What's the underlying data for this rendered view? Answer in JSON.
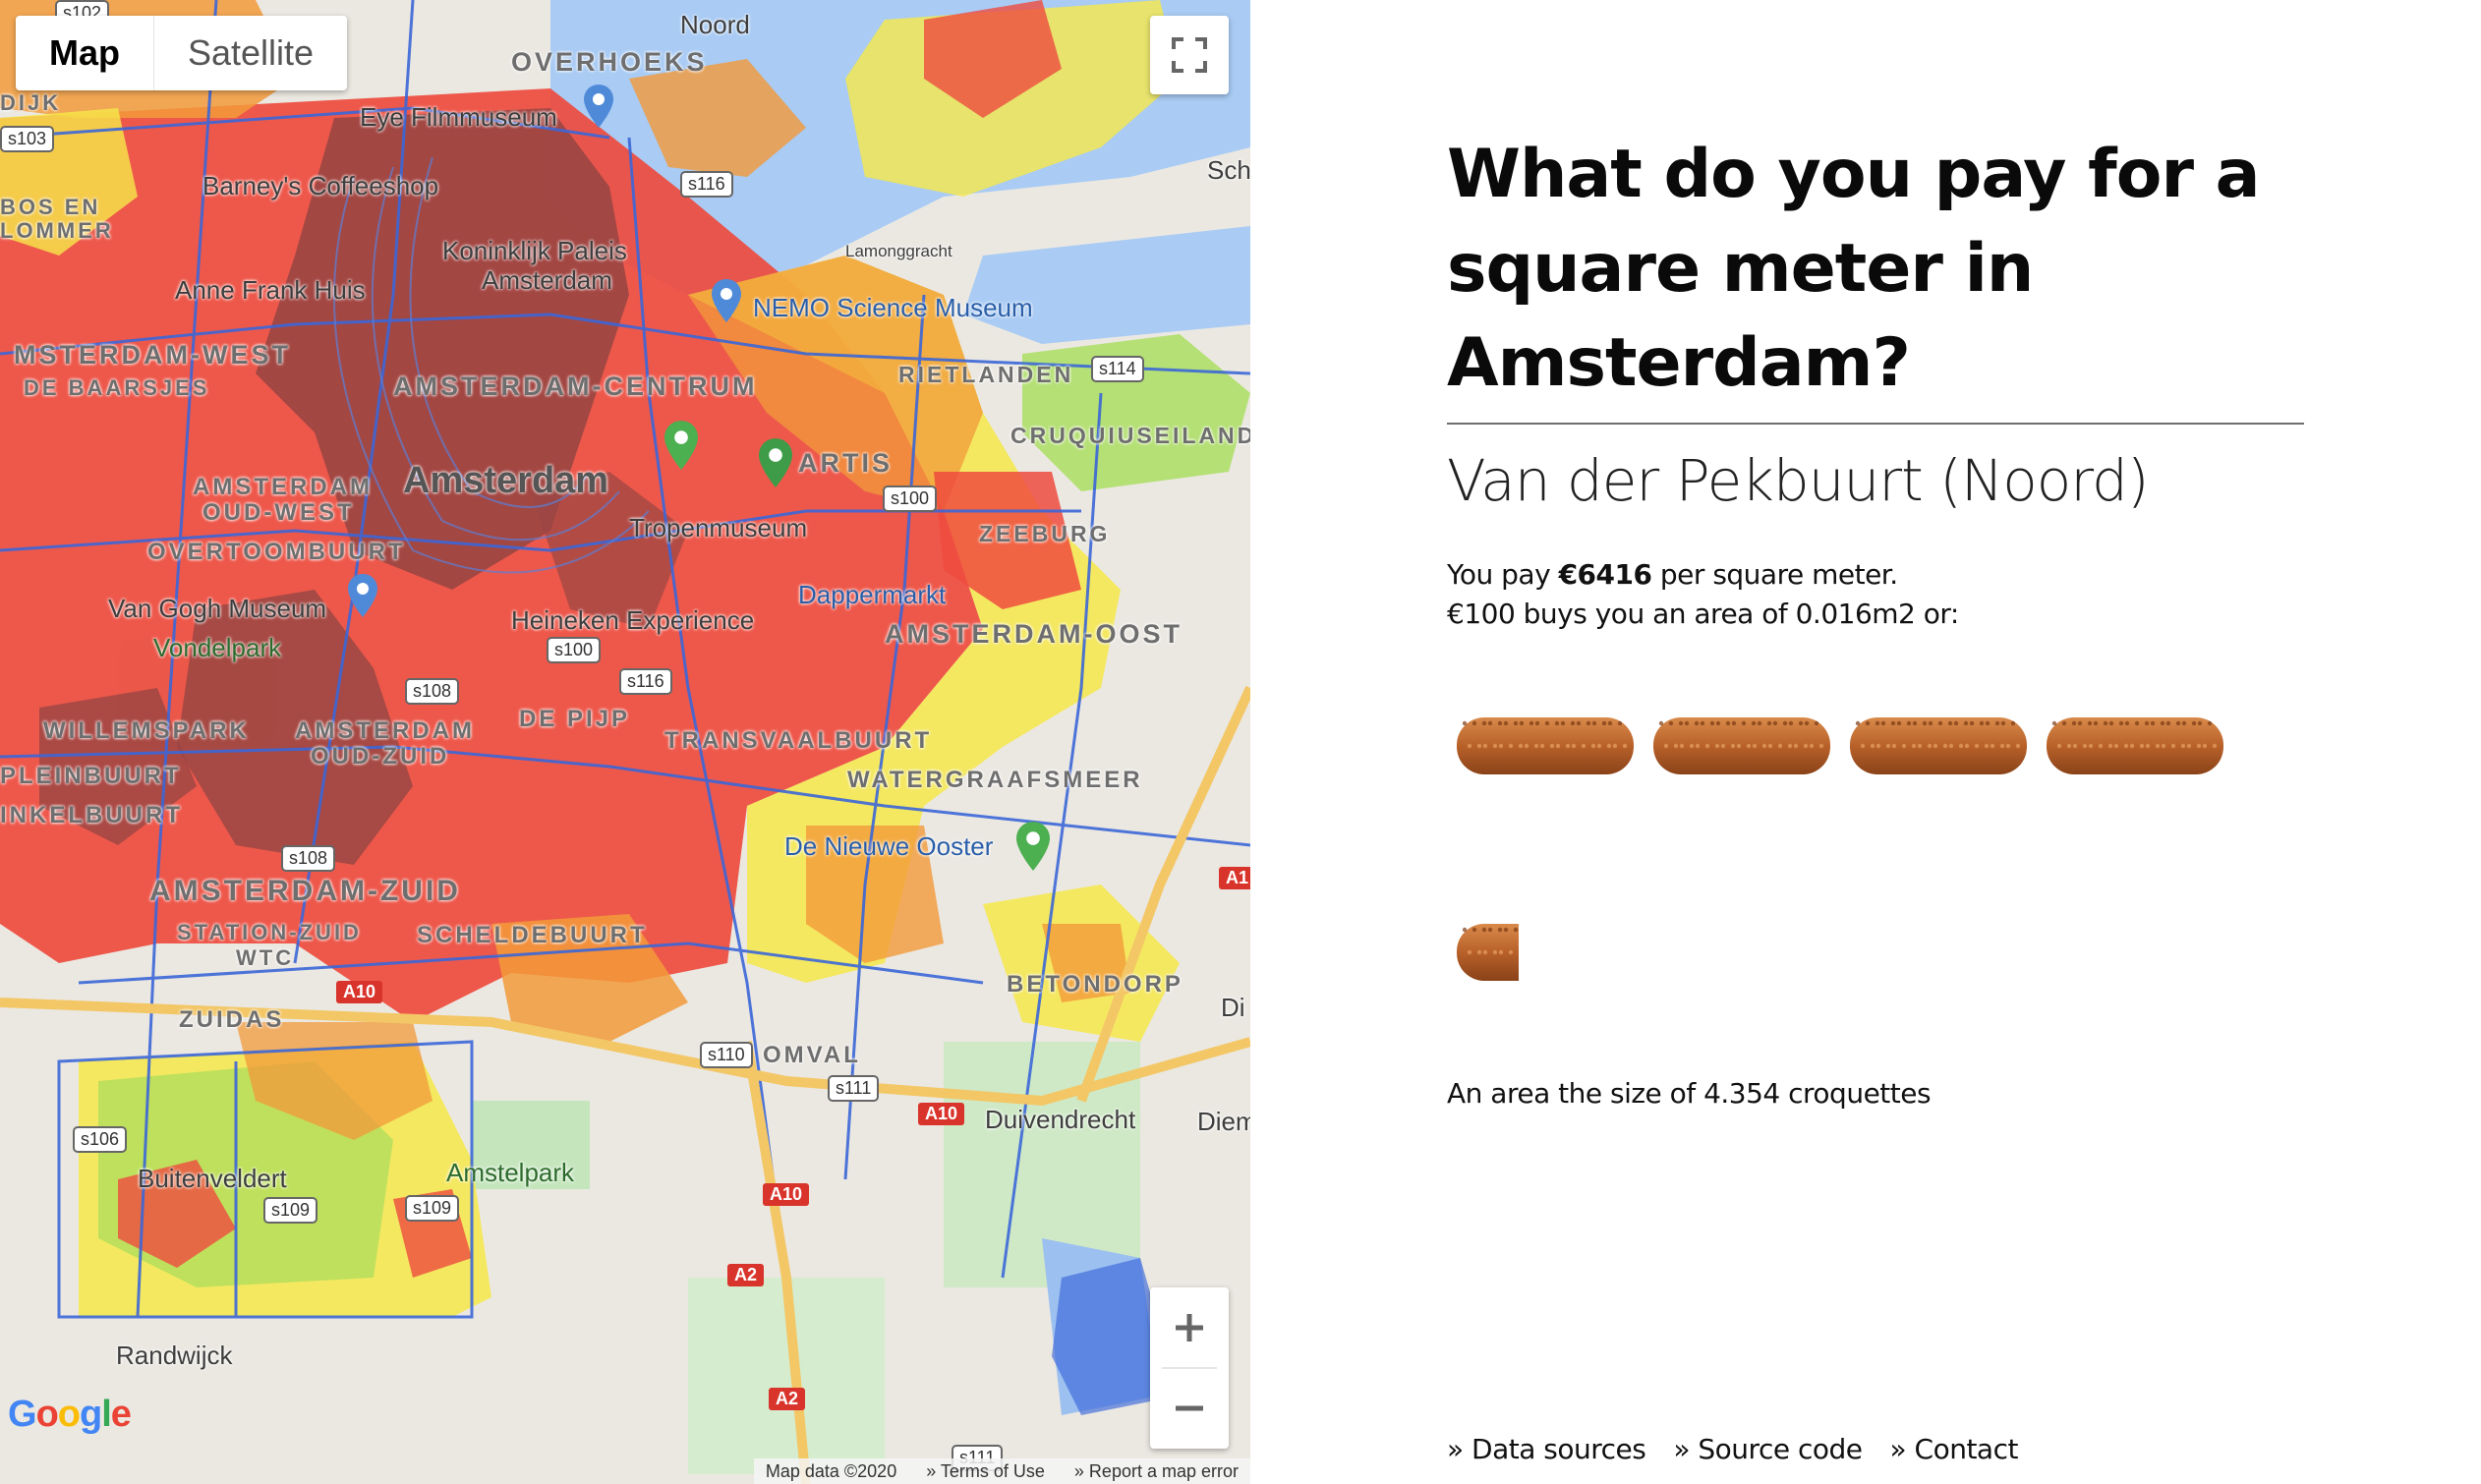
{
  "map": {
    "type_controls": {
      "map_label": "Map",
      "satellite_label": "Satellite"
    },
    "attribution": {
      "data": "Map data ©2020",
      "terms": "» Terms of Use",
      "report": "» Report a map error"
    },
    "logo_text": "Google",
    "labels": {
      "overhoeks": "OVERHOEKS",
      "eye": "Eye Filmmuseum",
      "barneys": "Barney's Coffeeshop",
      "paleis1": "Koninklijk Paleis",
      "paleis2": "Amsterdam",
      "annefrank": "Anne Frank Huis",
      "nemo": "NEMO Science Museum",
      "lamonggracht": "Lamonggracht",
      "west": "MSTERDAM-WEST",
      "centrum": "AMSTERDAM-CENTRUM",
      "rietlanden": "RIETLANDEN",
      "cruquius": "CRUQUIUSEILAND",
      "city": "Amsterdam",
      "artis": "ARTIS",
      "oudwest1": "AMSTERDAM",
      "oudwest2": "OUD-WEST",
      "tropen": "Tropenmuseum",
      "zeeburg": "ZEEBURG",
      "overtoom": "OVERTOOMBUURT",
      "vangogh": "Van Gogh Museum",
      "heineken": "Heineken Experience",
      "dappermarkt": "Dappermarkt",
      "oost": "AMSTERDAM-OOST",
      "vondelpark": "Vondelpark",
      "willemspark": "WILLEMSPARK",
      "oudzuid1": "AMSTERDAM",
      "oudzuid2": "OUD-ZUID",
      "depijp": "DE PIJP",
      "transvaal": "TRANSVAALBUURT",
      "plein": "PLEINBUURT",
      "watergraafsmeer": "WATERGRAAFSMEER",
      "nkel": "INKELBUURT",
      "nieuweooster": "De Nieuwe Ooster",
      "zuid": "AMSTERDAM-ZUID",
      "stationzuid1": "STATION-ZUID",
      "stationzuid2": "WTC",
      "scheldebuurt": "SCHELDEBUURT",
      "betondorp": "BETONDORP",
      "zuidas": "ZUIDAS",
      "omval": "OMVAL",
      "duivendrecht": "Duivendrecht",
      "diemen": "Diemen-Z",
      "buitenveldert": "Buitenveldert",
      "amstelpark": "Amstelpark",
      "randwijck": "Randwijck",
      "noord": "Noord",
      "sch": "Sch",
      "dijk": "DIJK",
      "bos": "BOS EN",
      "lommer": "LOMMER",
      "depark": "DE BAARSJES",
      "di": "Di",
      "a1": "A1"
    },
    "shields": [
      "s116",
      "s114",
      "s100",
      "s100",
      "s108",
      "s116",
      "s108",
      "s109",
      "s109",
      "s110",
      "s111",
      "s111",
      "s102",
      "s103",
      "s106"
    ],
    "motorways": [
      "A10",
      "A10",
      "A10",
      "A2",
      "A2"
    ]
  },
  "panel": {
    "title": "What do you pay for a square meter in Amsterdam?",
    "neighborhood": "Van der Pekbuurt (Noord)",
    "price_prefix": "You pay ",
    "price_value": "€6416",
    "price_suffix": " per square meter.",
    "hundred_line": "€100 buys you an area of 0.016m2 or:",
    "croquette_count": 4.354,
    "summary": "An area the size of 4.354 croquettes",
    "footer": {
      "data_sources": "» Data sources",
      "source_code": "» Source code",
      "contact": "» Contact"
    }
  },
  "colors": {
    "heat_red": "#ee4b3e",
    "heat_dark": "#9a4643",
    "heat_orange": "#f29a3a",
    "heat_yellow": "#f6e84a",
    "heat_green": "#a8dd5a",
    "water": "#a9cbf4",
    "road_blue": "#3b67d8"
  }
}
